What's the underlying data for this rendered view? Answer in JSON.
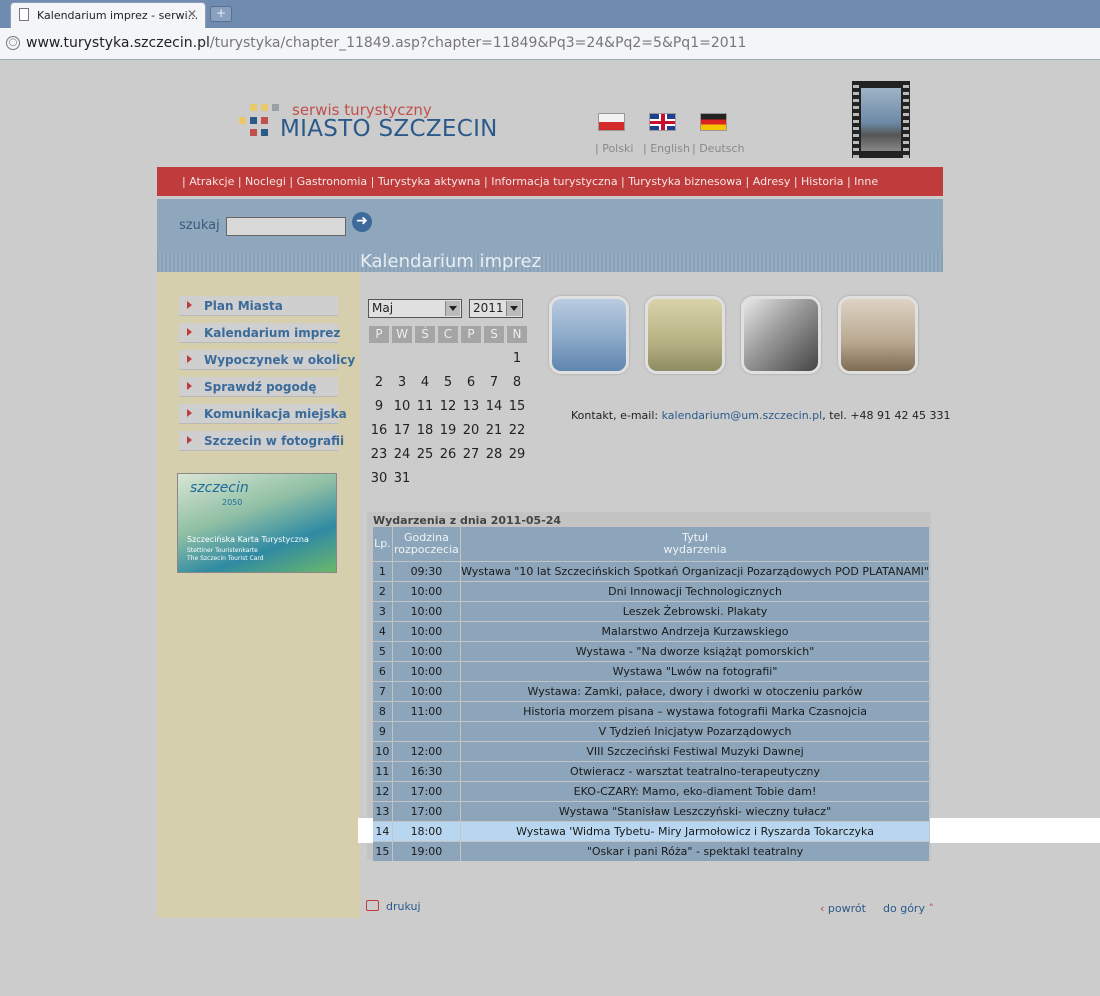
{
  "browser": {
    "tab_title": "Kalendarium imprez - serwi...",
    "tab_close": "✕",
    "new_tab": "+",
    "url_host": "www.turystyka.szczecin.pl",
    "url_path": "/turystyka/chapter_11849.asp?chapter=11849&Pq3=24&Pq2=5&Pq1=2011"
  },
  "header": {
    "logo_small": "serwis turystyczny",
    "logo_big": "MIASTO SZCZECIN",
    "languages": [
      {
        "label": "| Polski"
      },
      {
        "label": "| English"
      },
      {
        "label": "| Deutsch"
      }
    ]
  },
  "nav": {
    "links": "| Atrakcje | Noclegi | Gastronomia | Turystyka aktywna | Informacja turystyczna | Turystyka biznesowa | Adresy | Historia | Inne"
  },
  "search": {
    "label": "szukaj",
    "value": "",
    "go": "➜"
  },
  "page_title": "Kalendarium imprez",
  "sidebar": {
    "items": [
      {
        "label": "Plan Miasta"
      },
      {
        "label": "Kalendarium imprez"
      },
      {
        "label": "Wypoczynek w okolicy"
      },
      {
        "label": "Sprawdź pogodę"
      },
      {
        "label": "Komunikacja miejska"
      },
      {
        "label": "Szczecin w fotografii"
      }
    ],
    "card": {
      "brand": "szczecin",
      "brand2": "2050",
      "line1": "Szczecińska Karta Turystyczna",
      "line2": "Stettiner Touristenkarte",
      "line3": "The Szczecin Tourist Card"
    }
  },
  "calendar": {
    "month": "Maj",
    "year": "2011",
    "weekdays": [
      "P",
      "W",
      "Ś",
      "C",
      "P",
      "S",
      "N"
    ],
    "weeks": [
      [
        "",
        "",
        "",
        "",
        "",
        "",
        "1"
      ],
      [
        "2",
        "3",
        "4",
        "5",
        "6",
        "7",
        "8"
      ],
      [
        "9",
        "10",
        "11",
        "12",
        "13",
        "14",
        "15"
      ],
      [
        "16",
        "17",
        "18",
        "19",
        "20",
        "21",
        "22"
      ],
      [
        "23",
        "24",
        "25",
        "26",
        "27",
        "28",
        "29"
      ],
      [
        "30",
        "31",
        "",
        "",
        "",
        "",
        ""
      ]
    ]
  },
  "contact": {
    "prefix": "Kontakt, e-mail: ",
    "email": "kalendarium@um.szczecin.pl",
    "suffix": ", tel. +48 91 42 45 331"
  },
  "events": {
    "title": "Wydarzenia z dnia 2011-05-24",
    "headers": {
      "lp": "Lp.",
      "time_1": "Godzina",
      "time_2": "rozpoczecia",
      "title_1": "Tytuł",
      "title_2": "wydarzenia"
    },
    "rows": [
      {
        "lp": "1",
        "time": "09:30",
        "title": "Wystawa \"10 lat Szczecińskich Spotkań Organizacji Pozarządowych POD PLATANAMI\""
      },
      {
        "lp": "2",
        "time": "10:00",
        "title": "Dni Innowacji Technologicznych"
      },
      {
        "lp": "3",
        "time": "10:00",
        "title": "Leszek Żebrowski. Plakaty"
      },
      {
        "lp": "4",
        "time": "10:00",
        "title": "Malarstwo Andrzeja Kurzawskiego"
      },
      {
        "lp": "5",
        "time": "10:00",
        "title": "Wystawa - \"Na dworze książąt pomorskich\""
      },
      {
        "lp": "6",
        "time": "10:00",
        "title": "Wystawa \"Lwów na fotografii\""
      },
      {
        "lp": "7",
        "time": "10:00",
        "title": "Wystawa: Zamki, pałace, dwory i dworki w otoczeniu parków"
      },
      {
        "lp": "8",
        "time": "11:00",
        "title": "Historia morzem pisana – wystawa fotografii Marka Czasnojcia"
      },
      {
        "lp": "9",
        "time": "",
        "title": "V Tydzień Inicjatyw Pozarządowych"
      },
      {
        "lp": "10",
        "time": "12:00",
        "title": "VIII Szczeciński Festiwal Muzyki Dawnej"
      },
      {
        "lp": "11",
        "time": "16:30",
        "title": "Otwieracz - warsztat teatralno-terapeutyczny"
      },
      {
        "lp": "12",
        "time": "17:00",
        "title": "EKO-CZARY: Mamo, eko-diament Tobie dam!"
      },
      {
        "lp": "13",
        "time": "17:00",
        "title": "Wystawa \"Stanisław Leszczyński- wieczny tułacz\""
      },
      {
        "lp": "14",
        "time": "18:00",
        "title": "Wystawa 'Widma Tybetu- Miry Jarmołowicz i Ryszarda Tokarczyka"
      },
      {
        "lp": "15",
        "time": "19:00",
        "title": "\"Oskar i pani Róża\" - spektakl teatralny"
      }
    ]
  },
  "footer": {
    "print": "drukuj",
    "back": "powrót",
    "top": "do góry"
  },
  "colors": {
    "nav_red": "#c03b3b",
    "link_blue": "#2b5a8a",
    "table_blue": "#8ca5bb",
    "highlight": "#b8d6ef"
  }
}
